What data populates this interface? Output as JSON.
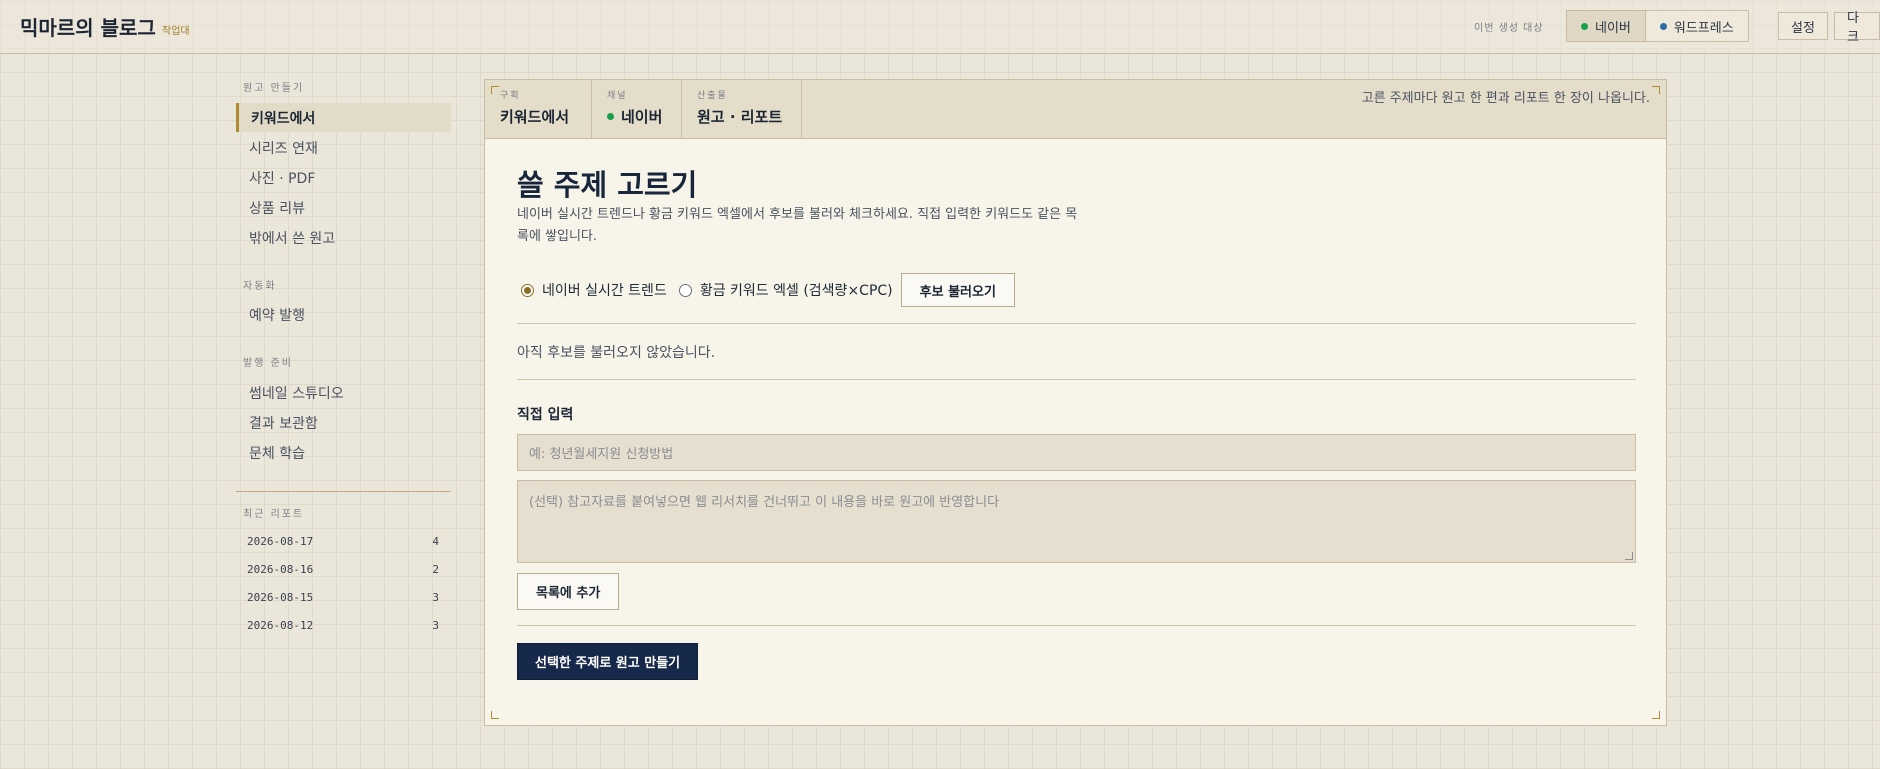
{
  "header": {
    "brand": "믹마르의 블로그",
    "brand_sub": "작업대",
    "target_label": "이번 생성 대상",
    "platforms": [
      {
        "label": "네이버",
        "dot_color": "#18a04a",
        "active": true
      },
      {
        "label": "워드프레스",
        "dot_color": "#2d6aa8",
        "active": false
      }
    ],
    "settings_label": "설정",
    "dark_label": "다크"
  },
  "sidebar": {
    "section_create": "원고 만들기",
    "create_items": [
      {
        "label": "키워드에서",
        "active": true
      },
      {
        "label": "시리즈 연재"
      },
      {
        "label": "사진 · PDF"
      },
      {
        "label": "상품 리뷰"
      },
      {
        "label": "밖에서 쓴 원고"
      }
    ],
    "section_auto": "자동화",
    "auto_items": [
      {
        "label": "예약 발행"
      }
    ],
    "section_publish": "발행 준비",
    "publish_items": [
      {
        "label": "썸네일 스튜디오"
      },
      {
        "label": "결과 보관함"
      },
      {
        "label": "문체 학습"
      }
    ],
    "section_reports": "최근 리포트",
    "reports": [
      {
        "date": "2026-08-17",
        "count": "4"
      },
      {
        "date": "2026-08-16",
        "count": "2"
      },
      {
        "date": "2026-08-15",
        "count": "3"
      },
      {
        "date": "2026-08-12",
        "count": "3"
      }
    ]
  },
  "steps": [
    {
      "key": "구획",
      "value": "키워드에서"
    },
    {
      "key": "채널",
      "value": "네이버",
      "dot_color": "#18a04a"
    },
    {
      "key": "산출물",
      "value": "원고 · 리포트"
    }
  ],
  "step_note": "고른 주제마다 원고 한 편과 리포트 한 장이 나옵니다.",
  "main": {
    "title": "쓸 주제 고르기",
    "description": "네이버 실시간 트렌드나 황금 키워드 엑셀에서 후보를 불러와 체크하세요. 직접 입력한 키워드도 같은 목록에 쌓입니다.",
    "source_options": [
      {
        "label": "네이버 실시간 트렌드",
        "selected": true
      },
      {
        "label": "황금 키워드 엑셀 (검색량×CPC)",
        "selected": false
      }
    ],
    "load_button": "후보 불러오기",
    "empty_message": "아직 후보를 불러오지 않았습니다.",
    "manual_section": "직접 입력",
    "keyword_placeholder": "예: 청년월세지원 신청방법",
    "reference_placeholder": "(선택) 참고자료를 붙여넣으면 웹 리서치를 건너뛰고 이 내용을 바로 원고에 반영합니다",
    "add_button": "목록에 추가",
    "generate_button": "선택한 주제로 원고 만들기"
  }
}
